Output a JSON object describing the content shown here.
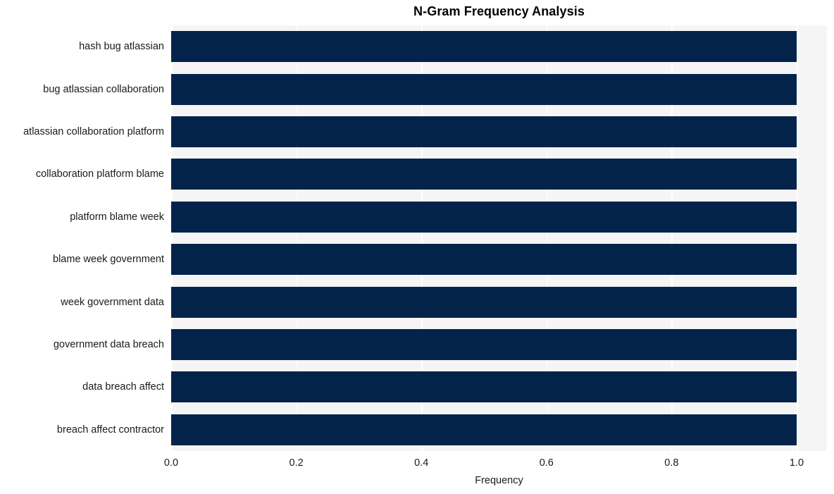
{
  "chart_data": {
    "type": "bar",
    "orientation": "horizontal",
    "title": "N-Gram Frequency Analysis",
    "xlabel": "Frequency",
    "ylabel": "",
    "categories": [
      "hash bug atlassian",
      "bug atlassian collaboration",
      "atlassian collaboration platform",
      "collaboration platform blame",
      "platform blame week",
      "blame week government",
      "week government data",
      "government data breach",
      "data breach affect",
      "breach affect contractor"
    ],
    "values": [
      1.0,
      1.0,
      1.0,
      1.0,
      1.0,
      1.0,
      1.0,
      1.0,
      1.0,
      1.0
    ],
    "xlim": [
      0.0,
      1.0
    ],
    "xticks": [
      "0.0",
      "0.2",
      "0.4",
      "0.6",
      "0.8",
      "1.0"
    ],
    "xtick_values": [
      0.0,
      0.2,
      0.4,
      0.6,
      0.8,
      1.0
    ],
    "grid": "vertical-white",
    "legend": null,
    "colors": {
      "bar": "#03234b",
      "plot_background": "#f5f5f5",
      "figure_background": "#ffffff",
      "gridline": "#ffffff",
      "text": "#1a1a1a",
      "title": "#000000"
    }
  }
}
